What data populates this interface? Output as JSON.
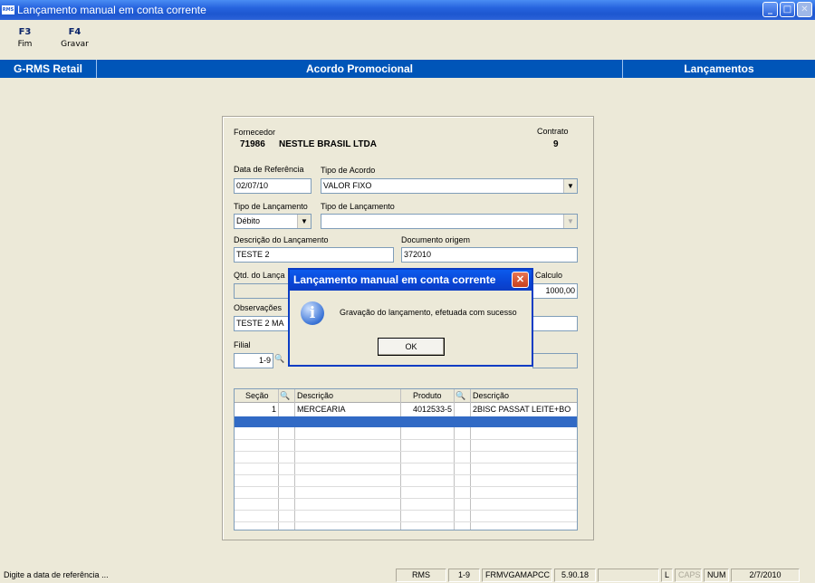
{
  "window": {
    "title": "Lançamento manual em conta corrente",
    "icon_text": "RMS",
    "minimize": "_",
    "maximize": "□",
    "close": "✕"
  },
  "fkeys": [
    {
      "key": "F3",
      "label": "Fim"
    },
    {
      "key": "F4",
      "label": "Gravar"
    }
  ],
  "header": {
    "left": "G-RMS Retail",
    "center": "Acordo Promocional",
    "right": "Lançamentos"
  },
  "form": {
    "fornecedor_label": "Fornecedor",
    "fornecedor_code": "71986",
    "fornecedor_name": "NESTLE BRASIL LTDA",
    "contrato_label": "Contrato",
    "contrato_value": "9",
    "data_ref_label": "Data de Referência",
    "data_ref_value": "02/07/10",
    "tipo_acordo_label": "Tipo de  Acordo",
    "tipo_acordo_value": "VALOR FIXO",
    "tipo_lanc_label": "Tipo de Lançamento",
    "tipo_lanc_value": "Débito",
    "tipo_lanc2_label": "Tipo de Lançamento",
    "tipo_lanc2_value": "",
    "descricao_label": "Descrição do Lançamento",
    "descricao_value": "TESTE 2",
    "documento_label": "Documento origem",
    "documento_value": "372010",
    "qtd_label": "Qtd. do Lança",
    "calculo_label": "Calculo",
    "calculo_value": "1000,00",
    "observacoes_label": "Observações",
    "observacoes_value": "TESTE 2  MA",
    "filial_label": "Filial",
    "filial_value": "1-9"
  },
  "grid": {
    "columns": [
      "Seção",
      "Descrição",
      "Produto",
      "Descrição"
    ],
    "rows": [
      {
        "secao": "1",
        "descricao": "MERCEARIA",
        "produto": "4012533-5",
        "descricao2": "2BISC PASSAT LEITE+BO"
      }
    ]
  },
  "dialog": {
    "title": "Lançamento manual em conta corrente",
    "message": "Gravação do lançamento, efetuada com sucesso",
    "ok_label": "OK",
    "close": "✕",
    "icon": "i"
  },
  "statusbar": {
    "message": "Digite a data de referência ...",
    "app": "RMS",
    "filial": "1-9",
    "form": "FRMVGAMAPCC",
    "version": "5.90.18",
    "blank": "",
    "l": "L",
    "caps": "CAPS",
    "num": "NUM",
    "date": "2/7/2010"
  }
}
